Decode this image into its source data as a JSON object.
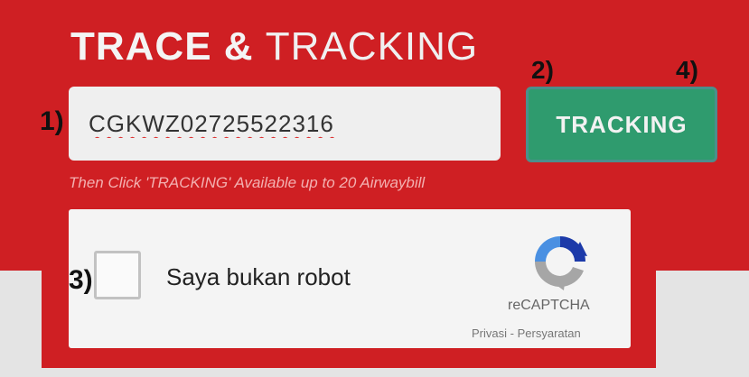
{
  "title": {
    "bold": "TRACE &",
    "light": "TRACKING"
  },
  "steps": {
    "s1": "1)",
    "s2": "2)",
    "s3": "3)",
    "s4": "4)"
  },
  "awb_input": {
    "value": "CGKWZ02725522316"
  },
  "tracking_button": {
    "label": "TRACKING"
  },
  "hint": "Then Click 'TRACKING' Available up to 20 Airwaybill",
  "captcha": {
    "checkbox_label": "Saya bukan robot",
    "brand": "reCAPTCHA",
    "privacy_link": "Privasi",
    "separator": "-",
    "terms_link": "Persyaratan"
  },
  "colors": {
    "panel_red": "#cf1f23",
    "button_green": "#2f9b6e",
    "hint_pink": "#f3b0b0"
  },
  "icons": {
    "captcha_logo": "recaptcha-logo-icon"
  }
}
